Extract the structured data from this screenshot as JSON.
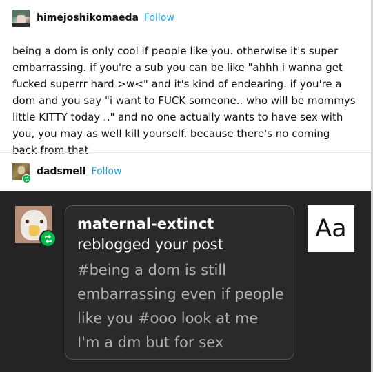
{
  "post": {
    "username": "himejoshikomaeda",
    "follow_label": "Follow",
    "text": "being a dom is only cool if people like you. otherwise it's super embarrassing. if you're a sub you can be like \"ahhh i wanna get fucked superrr hard >w<\" and it's kind of endearing. if you're a dom and you say \"i want to FUCK someone.. who will be mommys little KITTY today ..\" and no one actually wants to have sex with you, you may as well kill yourself. because there's no coming back from that"
  },
  "reblog": {
    "username": "dadsmell",
    "follow_label": "Follow"
  },
  "notification": {
    "username": "maternal-extinct",
    "action": "reblogged your post",
    "tags": "#being a dom is still embarrassing even if people like you #ooo look at me I'm a dm but for sex",
    "aa_label": "Aa"
  },
  "colors": {
    "follow": "#1fa3e0",
    "reblog_green": "#00b94a",
    "dark_bg": "#242424"
  }
}
